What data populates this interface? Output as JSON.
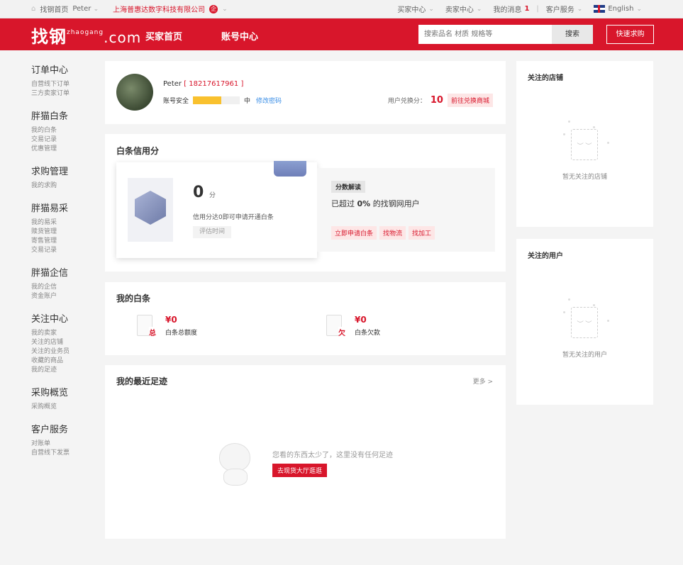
{
  "topbar": {
    "home": "找钢首页",
    "user": "Peter",
    "company": "上海普惠达数字科技有限公司",
    "company_badge": "企",
    "buyer_center": "买家中心",
    "seller_center": "卖家中心",
    "my_messages": "我的消息",
    "message_count": "1",
    "customer_service": "客户服务",
    "language": "English"
  },
  "header": {
    "logo_main": "找钢",
    "logo_sub": "zhaogang",
    "logo_domain": ".com",
    "nav_buyer_home": "买家首页",
    "nav_account": "账号中心",
    "search_placeholder": "搜索品名 材质 规格等",
    "search_button": "搜索",
    "quick_purchase": "快速求购"
  },
  "sidebar": {
    "groups": [
      {
        "title": "订单中心",
        "items": [
          "自营线下订单",
          "三方卖家订单"
        ]
      },
      {
        "title": "胖猫白条",
        "items": [
          "我的白条",
          "交易记录",
          "优惠管理"
        ]
      },
      {
        "title": "求购管理",
        "items": [
          "我的求购"
        ]
      },
      {
        "title": "胖猫易采",
        "items": [
          "我的易采",
          "赎货管理",
          "寄售管理",
          "交易记录"
        ]
      },
      {
        "title": "胖猫企信",
        "items": [
          "我的企信",
          "资金账户"
        ]
      },
      {
        "title": "关注中心",
        "items": [
          "我的卖家",
          "关注的店铺",
          "关注的业务员",
          "收藏的商品",
          "我的足迹"
        ]
      },
      {
        "title": "采购概览",
        "items": [
          "采购概览"
        ]
      },
      {
        "title": "客户服务",
        "items": [
          "对账单",
          "自营线下发票"
        ]
      }
    ]
  },
  "profile": {
    "name": "Peter",
    "phone": "[ 18217617961 ]",
    "security_label": "账号安全",
    "security_level": "中",
    "security_progress": 0.6,
    "change_password": "修改密码",
    "points_label": "用户兑换分：",
    "points_value": "10",
    "points_link": "前往兑换商城"
  },
  "credit": {
    "title": "白条信用分",
    "score": "0",
    "unit": "分",
    "hint": "信用分达0即可申请开通白条",
    "eval_button": "评估时间",
    "interp_tag": "分数解读",
    "interp_prefix": "已超过",
    "interp_percent": "0%",
    "interp_suffix": "的找钢网用户",
    "links": [
      "立即申请白条",
      "找物流",
      "找加工"
    ]
  },
  "baitiao": {
    "title": "我的白条",
    "total_icon_label": "总",
    "total_amount": "¥0",
    "total_desc": "白条总额度",
    "owed_icon_label": "欠",
    "owed_amount": "¥0",
    "owed_desc": "白条欠款"
  },
  "footprint": {
    "title": "我的最近足迹",
    "more": "更多 >",
    "empty_text": "您看的东西太少了，这里没有任何足迹",
    "empty_button": "去现货大厅逛逛"
  },
  "right": {
    "stores_title": "关注的店铺",
    "stores_empty": "暂无关注的店铺",
    "users_title": "关注的用户",
    "users_empty": "暂无关注的用户"
  },
  "colors": {
    "brand": "#d8162b",
    "security_bar": "#f9c12e",
    "link": "#3a8ee6"
  }
}
